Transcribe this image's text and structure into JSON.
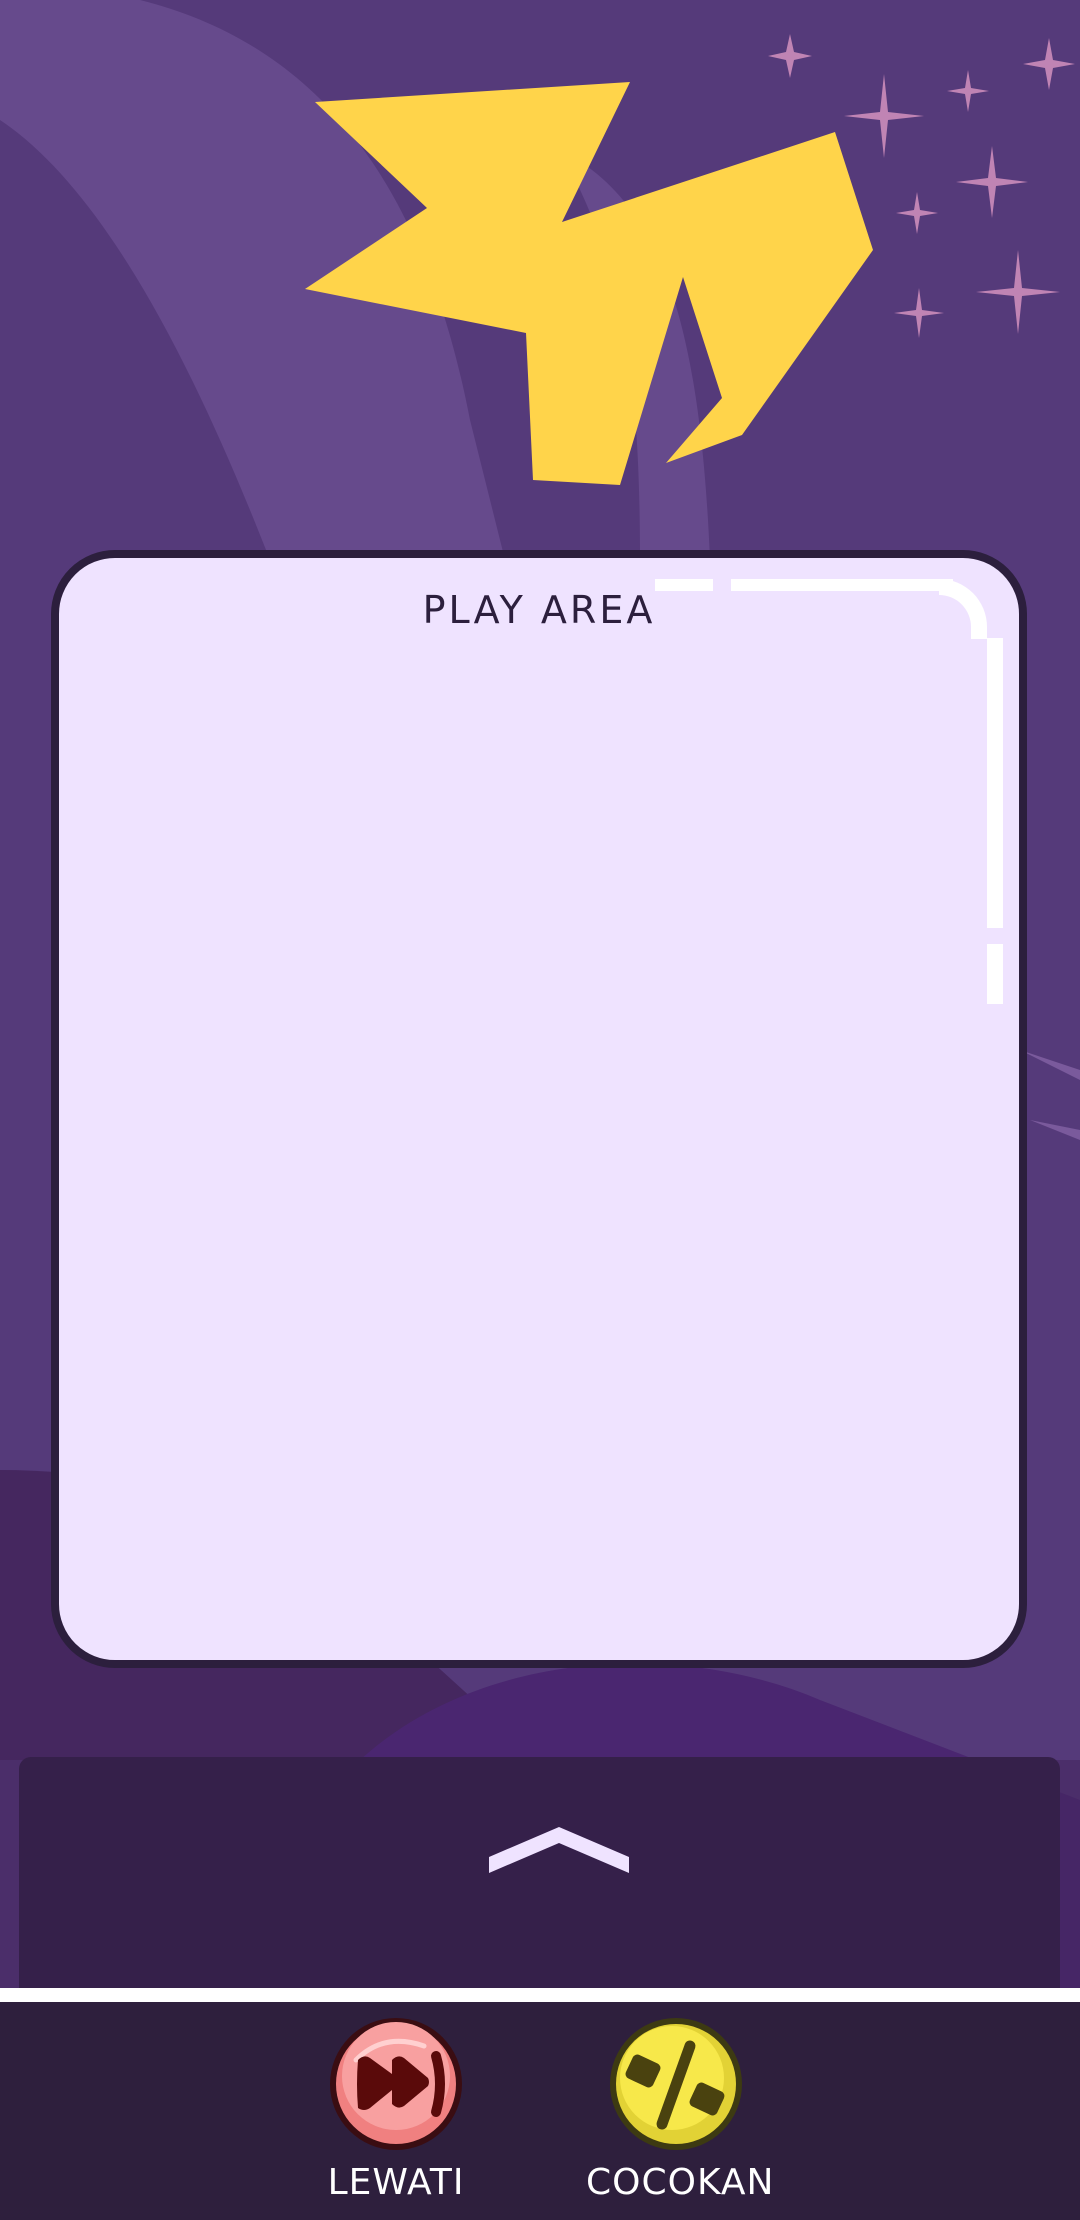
{
  "play_area": {
    "label": "PLAY AREA"
  },
  "drawer": {
    "toggle_icon": "chevron-up-icon"
  },
  "actions": [
    {
      "label": "LEWATI",
      "icon": "fast-forward-icon",
      "color": "#f08080"
    },
    {
      "label": "COCOKAN",
      "icon": "percent-match-icon",
      "color": "#f2e03a"
    }
  ],
  "colors": {
    "background": "#553a7a",
    "play_area_fill": "#efe3ff",
    "star_shape": "#ffd44a",
    "sparkle": "#c084b4",
    "bottom_bar": "#2e1f3d"
  }
}
